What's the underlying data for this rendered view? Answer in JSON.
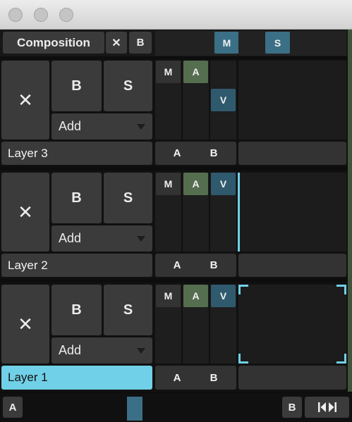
{
  "composition": {
    "label": "Composition",
    "close_glyph": "✕",
    "b_label": "B",
    "m_label": "M",
    "s_label": "S"
  },
  "layers": [
    {
      "name": "Layer 3",
      "close_glyph": "✕",
      "b_label": "B",
      "s_label": "S",
      "add_label": "Add",
      "m_label": "M",
      "a_label": "A",
      "v_label": "V",
      "crossfade_a": "A",
      "crossfade_b": "B"
    },
    {
      "name": "Layer 2",
      "close_glyph": "✕",
      "b_label": "B",
      "s_label": "S",
      "add_label": "Add",
      "m_label": "M",
      "a_label": "A",
      "v_label": "V",
      "crossfade_a": "A",
      "crossfade_b": "B"
    },
    {
      "name": "Layer 1",
      "close_glyph": "✕",
      "b_label": "B",
      "s_label": "S",
      "add_label": "Add",
      "m_label": "M",
      "a_label": "A",
      "v_label": "V",
      "crossfade_a": "A",
      "crossfade_b": "B"
    }
  ],
  "bottom_bar": {
    "a_label": "A",
    "b_label": "B",
    "transport_icon": "skip-to-start-end-icon",
    "crossfader_position": 0.43
  },
  "colors": {
    "accent_blue": "#70d0e7",
    "audio_green": "#556e4f",
    "video_blue": "#2f5a6e",
    "solo_blue": "#3b6f86"
  }
}
